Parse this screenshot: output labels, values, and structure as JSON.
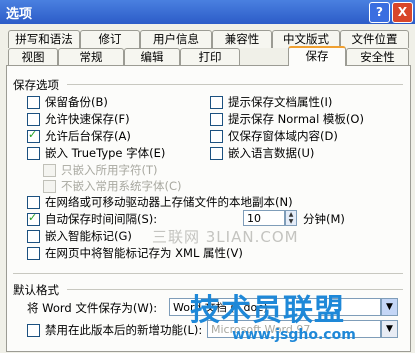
{
  "window": {
    "title": "选项",
    "help": "?",
    "close": "X"
  },
  "tabs_row1": [
    "拼写和语法",
    "修订",
    "用户信息",
    "兼容性",
    "中文版式",
    "文件位置"
  ],
  "tabs_row2": [
    "视图",
    "常规",
    "编辑",
    "打印",
    "保存",
    "安全性"
  ],
  "active_tab": "保存",
  "save_options": {
    "title": "保存选项",
    "left": [
      {
        "label": "保留备份(B)",
        "checked": false,
        "disabled": false
      },
      {
        "label": "允许快速保存(F)",
        "checked": false,
        "disabled": false
      },
      {
        "label": "允许后台保存(A)",
        "checked": true,
        "disabled": false
      },
      {
        "label": "嵌入 TrueType 字体(E)",
        "checked": false,
        "disabled": false
      },
      {
        "label": "只嵌入所用字符(T)",
        "checked": false,
        "disabled": true
      },
      {
        "label": "不嵌入常用系统字体(C)",
        "checked": false,
        "disabled": true
      }
    ],
    "right": [
      {
        "label": "提示保存文档属性(I)",
        "checked": false
      },
      {
        "label": "提示保存 Normal 模板(O)",
        "checked": false
      },
      {
        "label": "仅保存窗体域内容(D)",
        "checked": false
      },
      {
        "label": "嵌入语言数据(U)",
        "checked": false
      }
    ],
    "full": [
      {
        "label": "在网络或可移动驱动器上存储文件的本地副本(N)",
        "checked": false
      },
      {
        "label": "自动保存时间间隔(S):",
        "checked": true
      },
      {
        "label": "嵌入智能标记(G)",
        "checked": false
      },
      {
        "label": "在网页中将智能标记存为 XML 属性(V)",
        "checked": false
      }
    ],
    "autosave_value": "10",
    "autosave_unit": "分钟(M)"
  },
  "default_format": {
    "title": "默认格式",
    "save_as_label": "将 Word 文件保存为(W):",
    "save_as_value": "Word 文档 (*.doc)",
    "disable_features_label": "禁用在此版本后的新增功能(L):",
    "disable_features_value": "Microsoft Word 97"
  },
  "watermarks": {
    "w1": "三联网 3LIAN.COM",
    "w2": "技术员联盟",
    "w3": "www.jsgho.com"
  }
}
